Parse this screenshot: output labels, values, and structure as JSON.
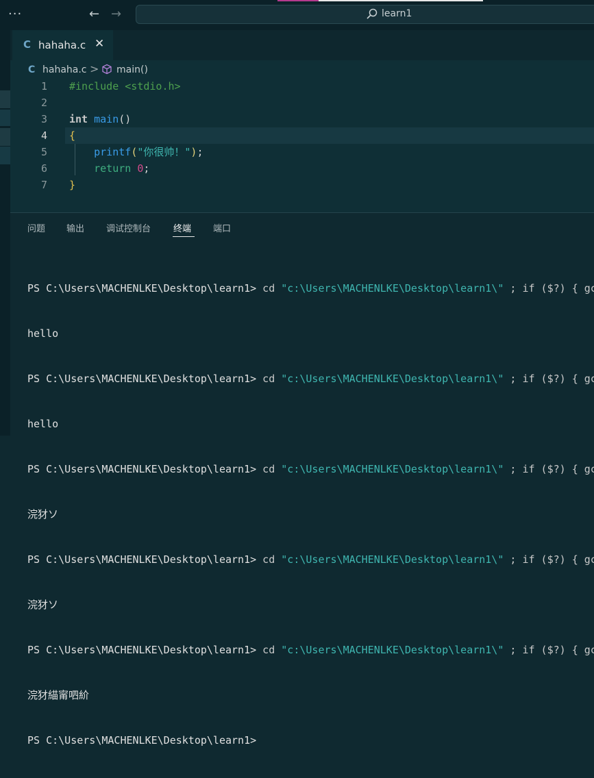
{
  "titlebar": {
    "menu_glyph": "···",
    "search_text": "learn1"
  },
  "tab": {
    "lang_icon": "C",
    "filename": "hahaha.c",
    "close_glyph": "✕"
  },
  "breadcrumb": {
    "lang_icon": "C",
    "file": "hahaha.c",
    "separator": ">",
    "symbol_icon": "cube-icon",
    "function": "main()"
  },
  "editor": {
    "current_line": 4,
    "lines": [
      {
        "n": "1",
        "text": "#include <stdio.h>"
      },
      {
        "n": "2",
        "text": ""
      },
      {
        "n": "3",
        "text": "int main()"
      },
      {
        "n": "4",
        "text": "{"
      },
      {
        "n": "5",
        "text": "    printf(\"你很帅！\");"
      },
      {
        "n": "6",
        "text": "    return 0;"
      },
      {
        "n": "7",
        "text": "}"
      }
    ]
  },
  "panel": {
    "tabs": [
      "问题",
      "输出",
      "调试控制台",
      "终端",
      "端口"
    ],
    "active_tab": "终端"
  },
  "terminal": {
    "prompt": "PS C:\\Users\\MACHENLKE\\Desktop\\learn1>",
    "cmd_word": " cd ",
    "cmd_path": "\"c:\\Users\\MACHENLKE\\Desktop\\learn1\\\"",
    "cmd_rest": " ; if ($?) { gc",
    "outputs": [
      "hello",
      "hello",
      "浣犲ソ",
      "浣犲ソ",
      "浣犲緢甯呬紒"
    ]
  },
  "colors": {
    "background": "#0f2930",
    "editor_bg": "#0f2f36",
    "keyword_blue": "#3a9ce8",
    "string_teal": "#3fb6b0",
    "include_green": "#4ea04e",
    "number_pink": "#d14a8a"
  }
}
